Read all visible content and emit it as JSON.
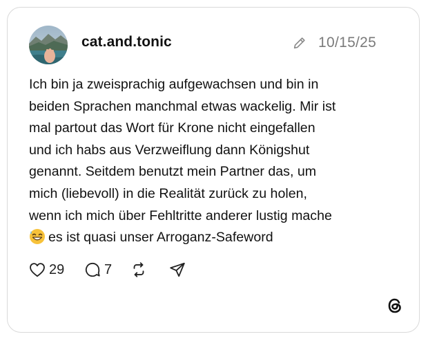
{
  "post": {
    "author": "cat.and.tonic",
    "date": "10/15/25",
    "text_lines": [
      "Ich bin ja zweisprachig aufgewachsen und bin in",
      "beiden Sprachen manchmal etwas wackelig. Mir ist",
      "mal partout das Wort für Krone nicht eingefallen",
      "und ich habs aus Verzweiflung dann Königshut",
      "genannt. Seitdem benutzt mein Partner das, um",
      "mich (liebevoll) in die Realität zurück zu holen,",
      "wenn ich mich über Fehltritte anderer lustig mache",
      "es ist quasi unser Arroganz-Safeword"
    ],
    "emoji": "grinning-face-with-sweat"
  },
  "actions": {
    "likes": "29",
    "replies": "7",
    "like_icon": "heart-icon",
    "reply_icon": "comment-icon",
    "repost_icon": "repost-icon",
    "share_icon": "share-icon"
  },
  "icons": {
    "edit": "pencil-icon",
    "brand": "threads-logo"
  }
}
